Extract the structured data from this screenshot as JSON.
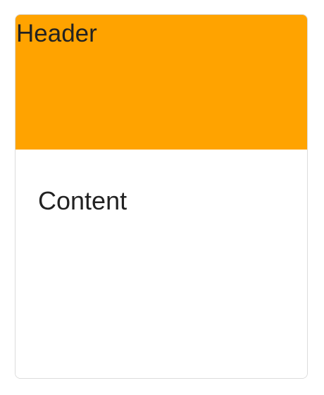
{
  "card": {
    "header_title": "Header",
    "content_text": "Content",
    "header_color": "#ffa300",
    "border_color": "#dcdcdc"
  }
}
